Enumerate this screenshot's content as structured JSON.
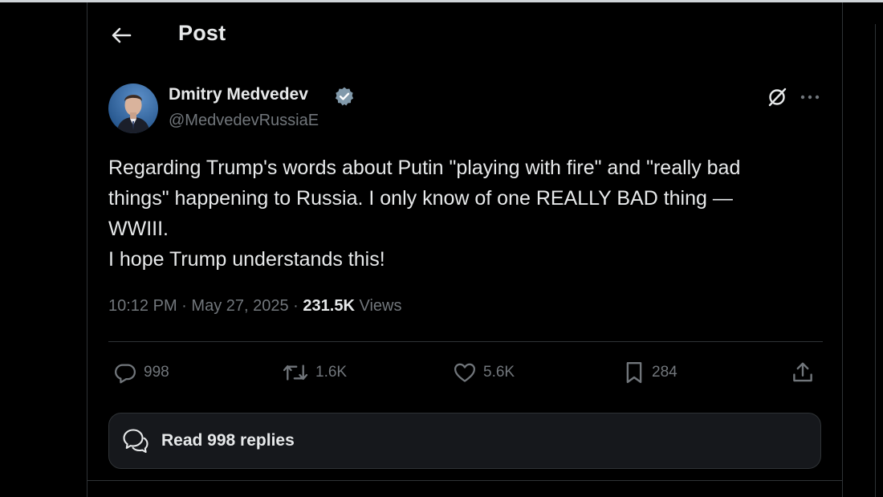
{
  "header": {
    "title": "Post",
    "back_icon": "arrow-left-icon"
  },
  "author": {
    "display_name": "Dmitry Medvedev",
    "handle": "@MedvedevRussiaE",
    "verified": true,
    "verified_color": "#829aab"
  },
  "post": {
    "lines": [
      "Regarding Trump's words about Putin \"playing with fire\" and \"really bad",
      "things\" happening to Russia. I only know of one REALLY BAD thing —",
      "WWIII.",
      "I hope Trump understands this!"
    ],
    "time": "10:12 PM",
    "separator": "·",
    "date": "May 27, 2025",
    "views_count": "231.5K",
    "views_label": "Views"
  },
  "actions": {
    "replies": "998",
    "reposts": "1.6K",
    "likes": "5.6K",
    "bookmarks": "284"
  },
  "read_replies": {
    "label": "Read 998 replies"
  },
  "colors": {
    "background": "#000000",
    "text": "#e7e9ea",
    "muted": "#71767b",
    "border": "#2f3336"
  }
}
